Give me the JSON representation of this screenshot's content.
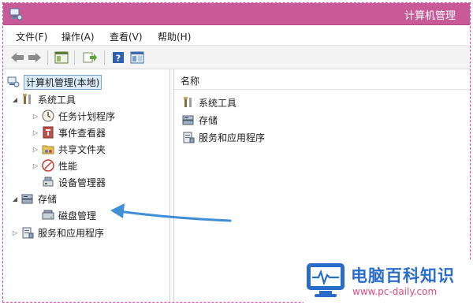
{
  "window": {
    "title": "计算机管理"
  },
  "menu": [
    "文件(F)",
    "操作(A)",
    "查看(V)",
    "帮助(H)"
  ],
  "toolbar": {
    "buttons": [
      "back-icon",
      "forward-icon",
      "console-tree-icon",
      "export-list-icon",
      "help-icon",
      "properties-icon"
    ]
  },
  "tree": {
    "root": "计算机管理(本地)",
    "system_tools": "系统工具",
    "task_scheduler": "任务计划程序",
    "event_viewer": "事件查看器",
    "shared_folders": "共享文件夹",
    "performance": "性能",
    "device_manager": "设备管理器",
    "storage": "存储",
    "disk_management": "磁盘管理",
    "services_apps": "服务和应用程序"
  },
  "list": {
    "header": "名称",
    "items": [
      "系统工具",
      "存储",
      "服务和应用程序"
    ]
  },
  "watermark": {
    "title": "电脑百科知识",
    "url": "www.pc-daily.com"
  },
  "colors": {
    "titlebar": "#c95a98",
    "arrow": "#3f8fd6",
    "watermark_blue": "#2a6cc9",
    "watermark_pink": "#d64b86"
  }
}
